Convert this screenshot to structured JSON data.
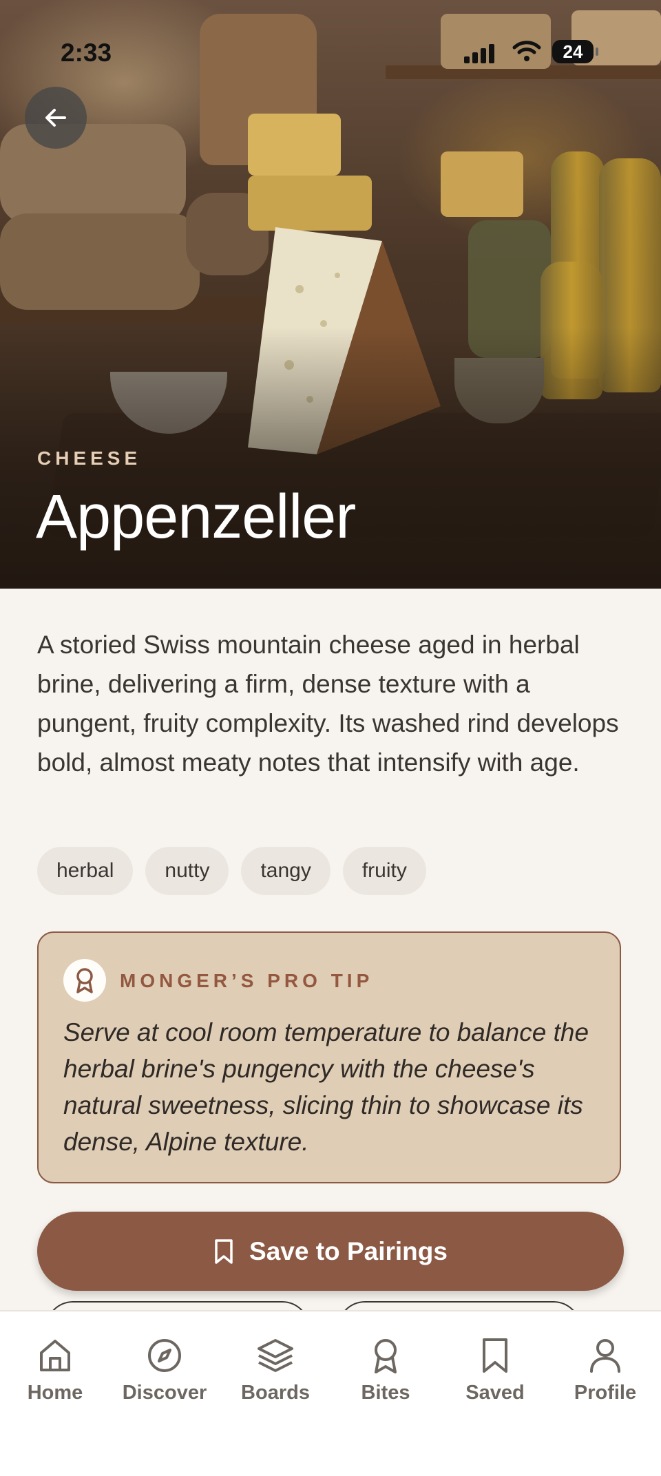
{
  "status_bar": {
    "time": "2:33",
    "battery": "24"
  },
  "hero": {
    "category": "CHEESE",
    "title": "Appenzeller"
  },
  "description": "A storied Swiss mountain cheese aged in herbal brine, delivering a firm, dense texture with a pungent, fruity complexity. Its washed rind develops bold, almost meaty notes that intensify with age.",
  "tags": [
    "herbal",
    "nutty",
    "tangy",
    "fruity"
  ],
  "pro_tip": {
    "label": "MONGER’S PRO TIP",
    "text": "Serve at cool room temperature to balance the herbal brine's pungency with the cheese's natural sweetness, slicing thin to showcase its dense, Alpine texture.",
    "icon": "award-icon"
  },
  "save_button": {
    "label": "Save to Pairings",
    "icon": "bookmark-icon"
  },
  "nav": [
    {
      "label": "Home",
      "icon": "home-icon"
    },
    {
      "label": "Discover",
      "icon": "compass-icon"
    },
    {
      "label": "Boards",
      "icon": "layers-icon"
    },
    {
      "label": "Bites",
      "icon": "award-icon"
    },
    {
      "label": "Saved",
      "icon": "bookmark-icon"
    },
    {
      "label": "Profile",
      "icon": "user-icon"
    }
  ],
  "colors": {
    "accent": "#8c5944",
    "tip_bg": "#dfcdb6",
    "tip_label": "#93583f",
    "page_bg": "#f7f4ef"
  }
}
